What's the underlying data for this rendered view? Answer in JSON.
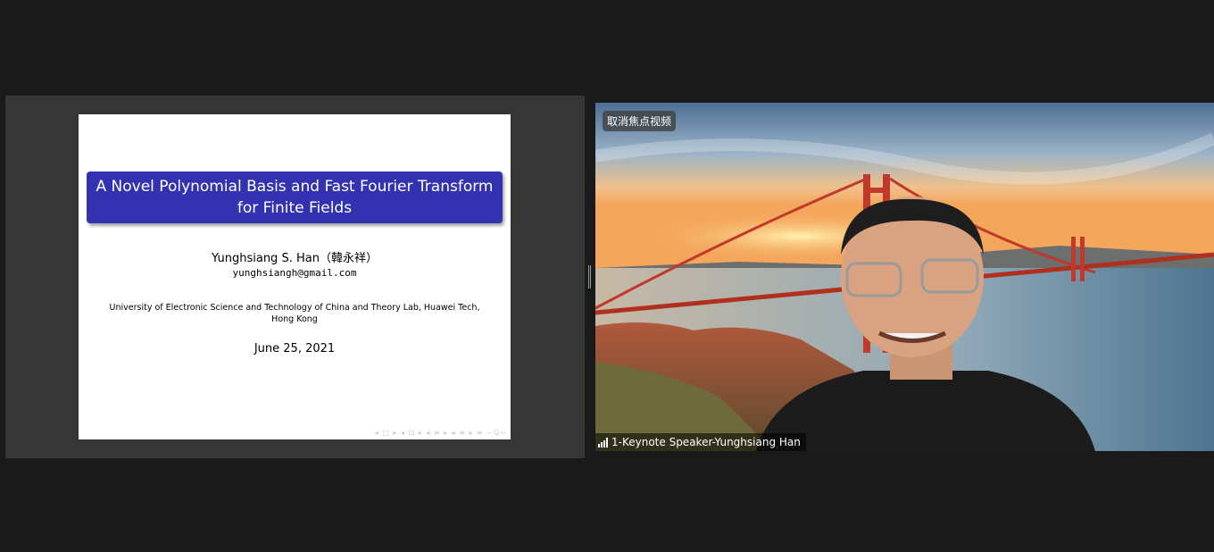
{
  "slide": {
    "title_line1": "A Novel Polynomial Basis and Fast Fourier Transform",
    "title_line2": "for Finite Fields",
    "author": "Yunghsiang S. Han（韓永祥）",
    "email": "yunghsiangh@gmail.com",
    "affiliation_line1": "University of Electronic Science and Technology of China and Theory Lab, Huawei Tech,",
    "affiliation_line2": "Hong Kong",
    "date": "June 25, 2021",
    "nav_icons": "◂ □ ▸ ◂ ⊡ ▸ ◂ ≡ ▸ ◂ ≡ ▸ ≡ ∽Q∾",
    "title_bg_color": "#3333b2"
  },
  "video": {
    "unpin_label": "取消焦点视频",
    "participant_name": "1-Keynote Speaker-Yunghsiang Han",
    "signal_icon": "signal-strength-icon"
  }
}
